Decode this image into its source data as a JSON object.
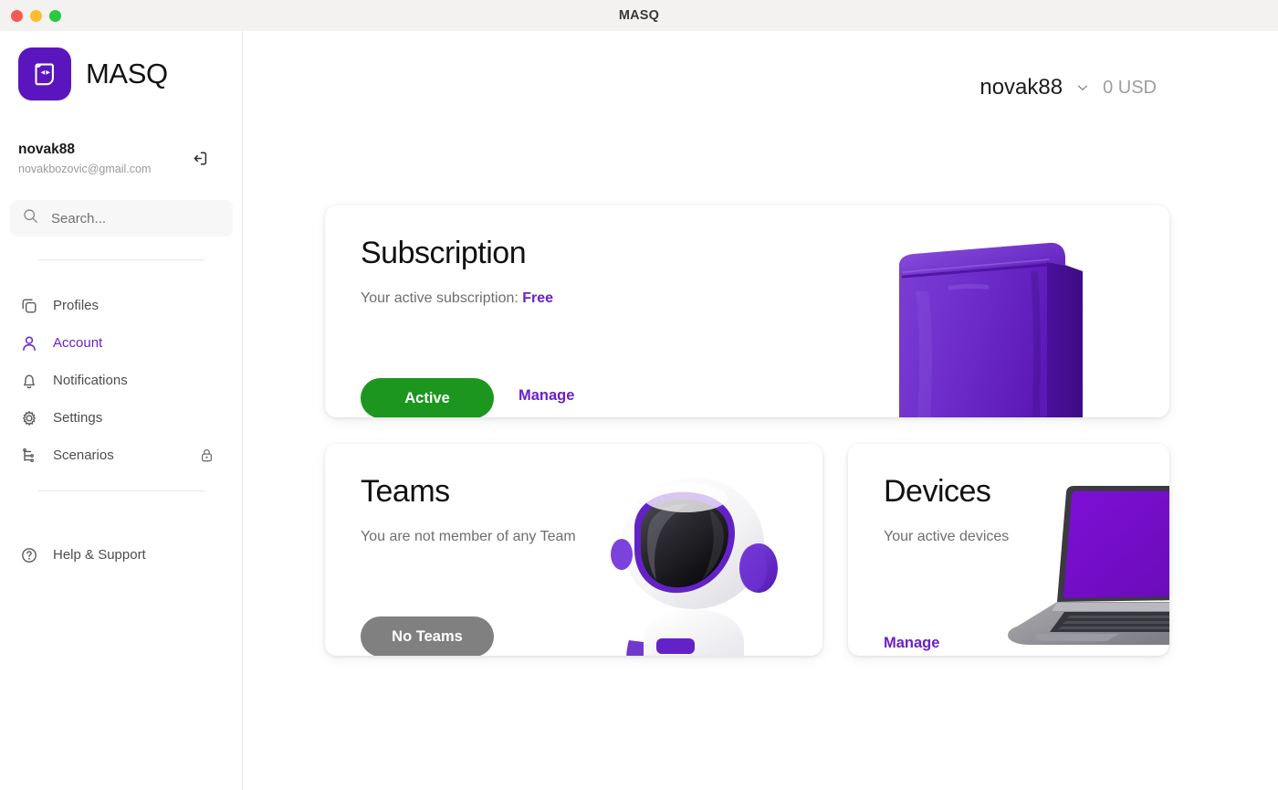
{
  "window": {
    "title": "MASQ",
    "traffic_lights": [
      "close",
      "minimize",
      "maximize"
    ],
    "colors": {
      "close": "#f45b55",
      "minimize": "#fbbd2e",
      "maximize": "#27c93f"
    }
  },
  "brand": {
    "name": "MASQ",
    "logo_icon": "masq-mask-logo-icon",
    "logo_color": "#5b15bf"
  },
  "sidebar": {
    "account": {
      "name": "novak88",
      "email": "novakbozovic@gmail.com",
      "logout_icon": "logout-icon"
    },
    "search": {
      "placeholder": "Search...",
      "value": "",
      "icon": "search-icon"
    },
    "items": [
      {
        "label": "Profiles",
        "icon": "profiles-copy-icon",
        "active": false,
        "locked": false
      },
      {
        "label": "Account",
        "icon": "user-icon",
        "active": true,
        "locked": false
      },
      {
        "label": "Notifications",
        "icon": "bell-icon",
        "active": false,
        "locked": false
      },
      {
        "label": "Settings",
        "icon": "gear-icon",
        "active": false,
        "locked": false
      },
      {
        "label": "Scenarios",
        "icon": "scenarios-tree-icon",
        "active": false,
        "locked": true,
        "lock_icon": "lock-icon"
      }
    ],
    "help": {
      "label": "Help & Support",
      "icon": "question-circle-icon"
    }
  },
  "topbar": {
    "user": "novak88",
    "chevron_icon": "chevron-down-icon",
    "balance": "0 USD"
  },
  "cards": {
    "subscription": {
      "title": "Subscription",
      "subtitle_prefix": "Your active subscription: ",
      "plan": "Free",
      "status_button": "Active",
      "manage_link": "Manage",
      "illustration": "purple-pouch-bag-illustration",
      "status_color": "#1d9620"
    },
    "teams": {
      "title": "Teams",
      "subtitle": "You are not member of any Team",
      "status_button": "No Teams",
      "illustration": "white-purple-robot-illustration",
      "status_color": "#808080"
    },
    "devices": {
      "title": "Devices",
      "subtitle": "Your active devices",
      "manage_link": "Manage",
      "illustration": "laptop-purple-screen-illustration"
    }
  },
  "theme": {
    "accent_purple": "#6b21c8",
    "logo_purple": "#5b15bf",
    "green": "#1d9620",
    "gray": "#808080"
  }
}
